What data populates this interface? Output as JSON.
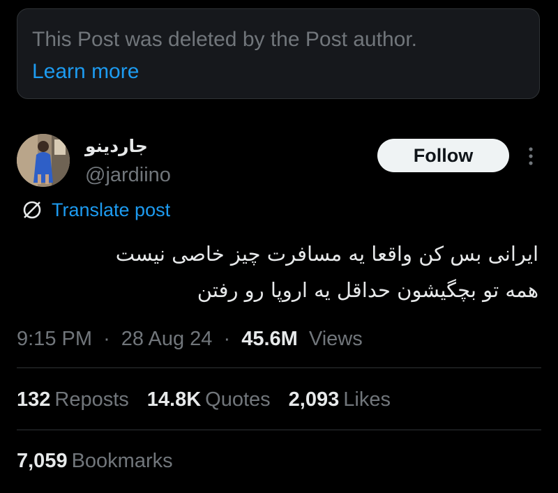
{
  "deleted_notice": {
    "text": "This Post was deleted by the Post author.",
    "link": "Learn more"
  },
  "author": {
    "display_name": "جاردینو",
    "handle": "@jardiino",
    "avatar_icon": "user-avatar-photo"
  },
  "follow_label": "Follow",
  "more_icon": "more-vertical-icon",
  "translate": {
    "icon": "globe-translate-icon",
    "label": "Translate post"
  },
  "post": {
    "lines": [
      "ایرانی بس کن واقعا یه مسافرت چیز خاصی نیست",
      "همه تو بچگیشون حداقل یه اروپا رو رفتن"
    ]
  },
  "meta": {
    "time": "9:15 PM",
    "separator": "·",
    "date": "28 Aug 24",
    "views_count": "45.6M",
    "views_label": "Views"
  },
  "stats": [
    {
      "count": "132",
      "label": "Reposts"
    },
    {
      "count": "14.8K",
      "label": "Quotes"
    },
    {
      "count": "2,093",
      "label": "Likes"
    }
  ],
  "bookmarks": {
    "count": "7,059",
    "label": "Bookmarks"
  },
  "colors": {
    "background": "#000000",
    "text_primary": "#e7e9ea",
    "text_secondary": "#71767b",
    "accent": "#1d9bf0",
    "border": "#2f3336",
    "follow_bg": "#eff3f4"
  }
}
